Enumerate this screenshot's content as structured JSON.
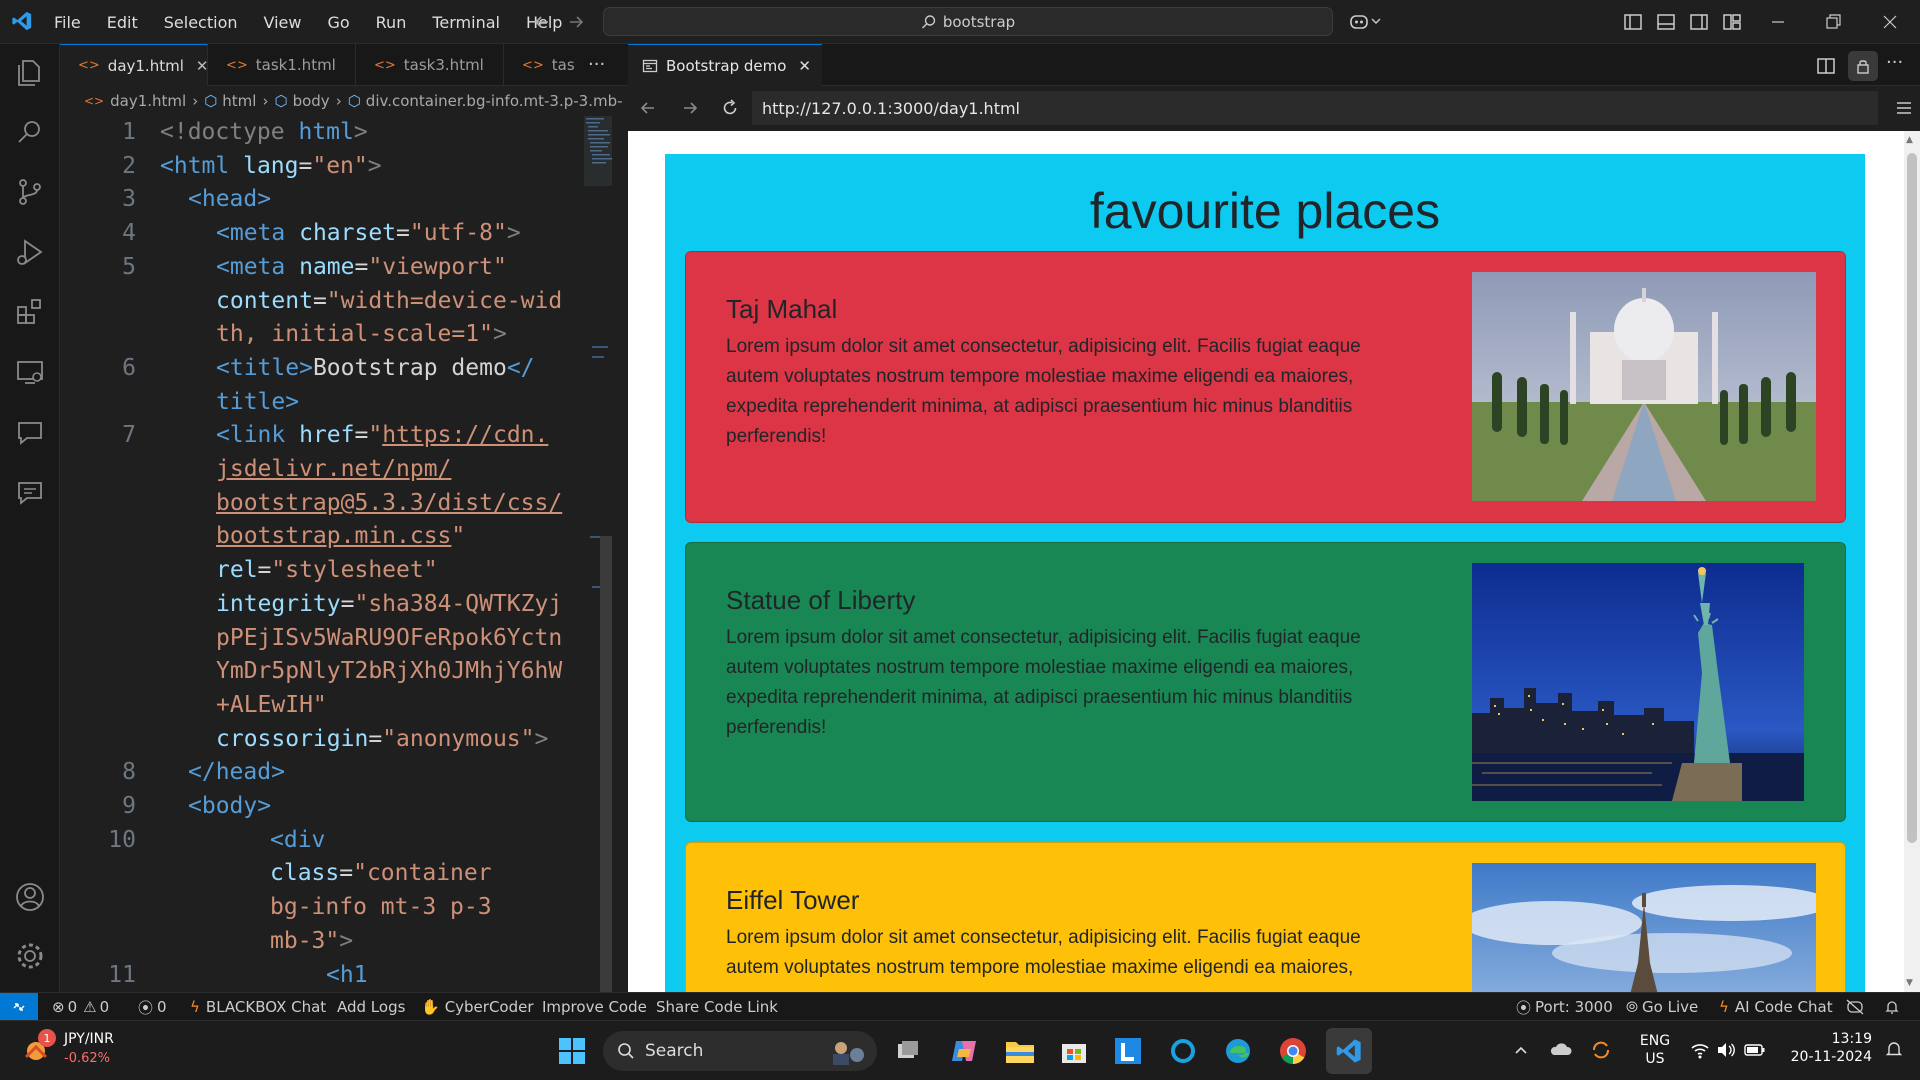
{
  "menu": [
    "File",
    "Edit",
    "Selection",
    "View",
    "Go",
    "Run",
    "Terminal",
    "Help"
  ],
  "search": {
    "text": "bootstrap"
  },
  "editor": {
    "tabs": [
      "day1.html",
      "task1.html",
      "task3.html",
      "task"
    ],
    "breadcrumb": [
      "day1.html",
      "html",
      "body",
      "div.container.bg-info.mt-3.p-3.mb-"
    ],
    "line_numbers": [
      "1",
      "2",
      "3",
      "4",
      "5",
      "",
      "",
      "6",
      "",
      "7",
      "",
      "",
      "",
      "",
      "",
      "",
      "",
      "",
      "",
      "8",
      "9",
      "10",
      "",
      "",
      "",
      "11"
    ],
    "code": {
      "l1a": "<!doctype ",
      "l1b": "html",
      "l1c": ">",
      "l2a": "<html ",
      "l2b": "lang",
      "l2c": "=",
      "l2d": "\"en\"",
      "l2e": ">",
      "l3a": "<head>",
      "l4a": "<meta ",
      "l4b": "charset",
      "l4c": "=",
      "l4d": "\"utf-8\"",
      "l4e": ">",
      "l5a": "<meta ",
      "l5b": "name",
      "l5c": "=",
      "l5d": "\"viewport\"",
      "l5f": "content",
      "l5g": "=",
      "l5h": "\"width=device-wid",
      "l5i": "th, initial-scale=1\"",
      "l5j": ">",
      "l6a": "<title>",
      "l6b": "Bootstrap demo",
      "l6c": "</",
      "l6d": "title>",
      "l7a": "<link ",
      "l7b": "href",
      "l7c": "=",
      "l7d": "\"",
      "l7e": "https://cdn.",
      "l7f": "jsdelivr.net/npm/",
      "l7g": "bootstrap@5.3.3/dist/css/",
      "l7h": "bootstrap.min.css",
      "l7i": "\"",
      "l7j": "rel",
      "l7k": "=",
      "l7l": "\"stylesheet\"",
      "l7m": "integrity",
      "l7n": "=",
      "l7o": "\"sha384-QWTKZyj",
      "l7p": "pPEjISv5WaRU9OFeRpok6Yctn",
      "l7q": "YmDr5pNlyT2bRjXh0JMhjY6hW",
      "l7r": "+ALEwIH\"",
      "l7s": "crossorigin",
      "l7t": "=",
      "l7u": "\"anonymous\"",
      "l7v": ">",
      "l8a": "</head>",
      "l9a": "<body>",
      "l10a": "<div",
      "l10b": "class",
      "l10c": "=",
      "l10d": "\"container",
      "l10e": "bg-info mt-3 p-3",
      "l10f": "mb-3\"",
      "l10g": ">",
      "l11a": "<h1"
    }
  },
  "browser": {
    "tab_title": "Bootstrap demo",
    "url": "http://127.0.0.1:3000/day1.html",
    "page": {
      "heading": "favourite places",
      "cards": [
        {
          "title": "Taj Mahal",
          "text": "Lorem ipsum dolor sit amet consectetur, adipisicing elit. Facilis fugiat eaque autem voluptates nostrum tempore molestiae maxime eligendi ea maiores, expedita reprehenderit minima, at adipisci praesentium hic minus blanditiis perferendis!",
          "bg": "#dc3545"
        },
        {
          "title": "Statue of Liberty",
          "text": "Lorem ipsum dolor sit amet consectetur, adipisicing elit. Facilis fugiat eaque autem voluptates nostrum tempore molestiae maxime eligendi ea maiores, expedita reprehenderit minima, at adipisci praesentium hic minus blanditiis perferendis!",
          "bg": "#198754"
        },
        {
          "title": "Eiffel Tower",
          "text": "Lorem ipsum dolor sit amet consectetur, adipisicing elit. Facilis fugiat eaque autem voluptates nostrum tempore molestiae maxime eligendi ea maiores,",
          "bg": "#ffc107"
        }
      ]
    }
  },
  "statusbar": {
    "errors": "0",
    "warnings": "0",
    "ports": "0",
    "left_items": [
      "BLACKBOX Chat",
      "Add Logs",
      "CyberCoder",
      "Improve Code",
      "Share Code Link"
    ],
    "port": "Port: 3000",
    "golive": "Go Live",
    "aichat": "AI Code Chat"
  },
  "taskbar": {
    "ticker_name": "JPY/INR",
    "ticker_change": "-0.62%",
    "badge": "1",
    "search_label": "Search",
    "lang_line1": "ENG",
    "lang_line2": "US",
    "time": "13:19",
    "date": "20-11-2024"
  },
  "colors": {
    "accent": "#0078d4",
    "info": "#0dcaf0",
    "danger": "#dc3545",
    "success": "#198754",
    "warning": "#ffc107"
  }
}
